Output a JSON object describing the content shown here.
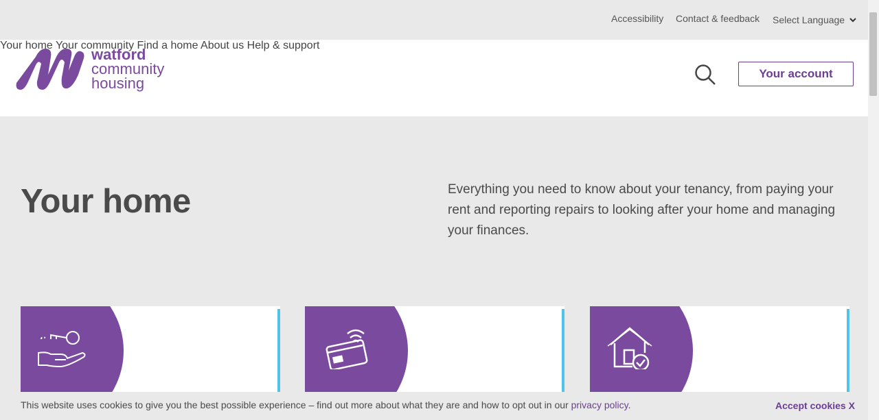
{
  "topbar": {
    "accessibility": "Accessibility",
    "contact": "Contact & feedback",
    "language": "Select Language"
  },
  "logo": {
    "line1": "watford",
    "line2": "community",
    "line3": "housing"
  },
  "nav": {
    "items": [
      "Your home",
      "Your community",
      "Find a home",
      "About us",
      "Help & support"
    ]
  },
  "account_button": "Your account",
  "hero": {
    "title": "Your home",
    "description": "Everything you need to know about your tenancy, from paying your rent and reporting repairs to looking after your home and managing your finances."
  },
  "cards": [
    {
      "icon": "hand-key-icon"
    },
    {
      "icon": "contactless-card-icon"
    },
    {
      "icon": "house-check-icon"
    }
  ],
  "cookie": {
    "text": "This website uses cookies to give you the best possible experience – find out more about what they are and how to opt out in our ",
    "link": "privacy policy",
    "suffix": ".",
    "accept": "Accept cookies X"
  },
  "colors": {
    "brand_purple": "#7a4a9e",
    "accent_blue": "#4fc3e8",
    "background": "#e9e9e9"
  }
}
